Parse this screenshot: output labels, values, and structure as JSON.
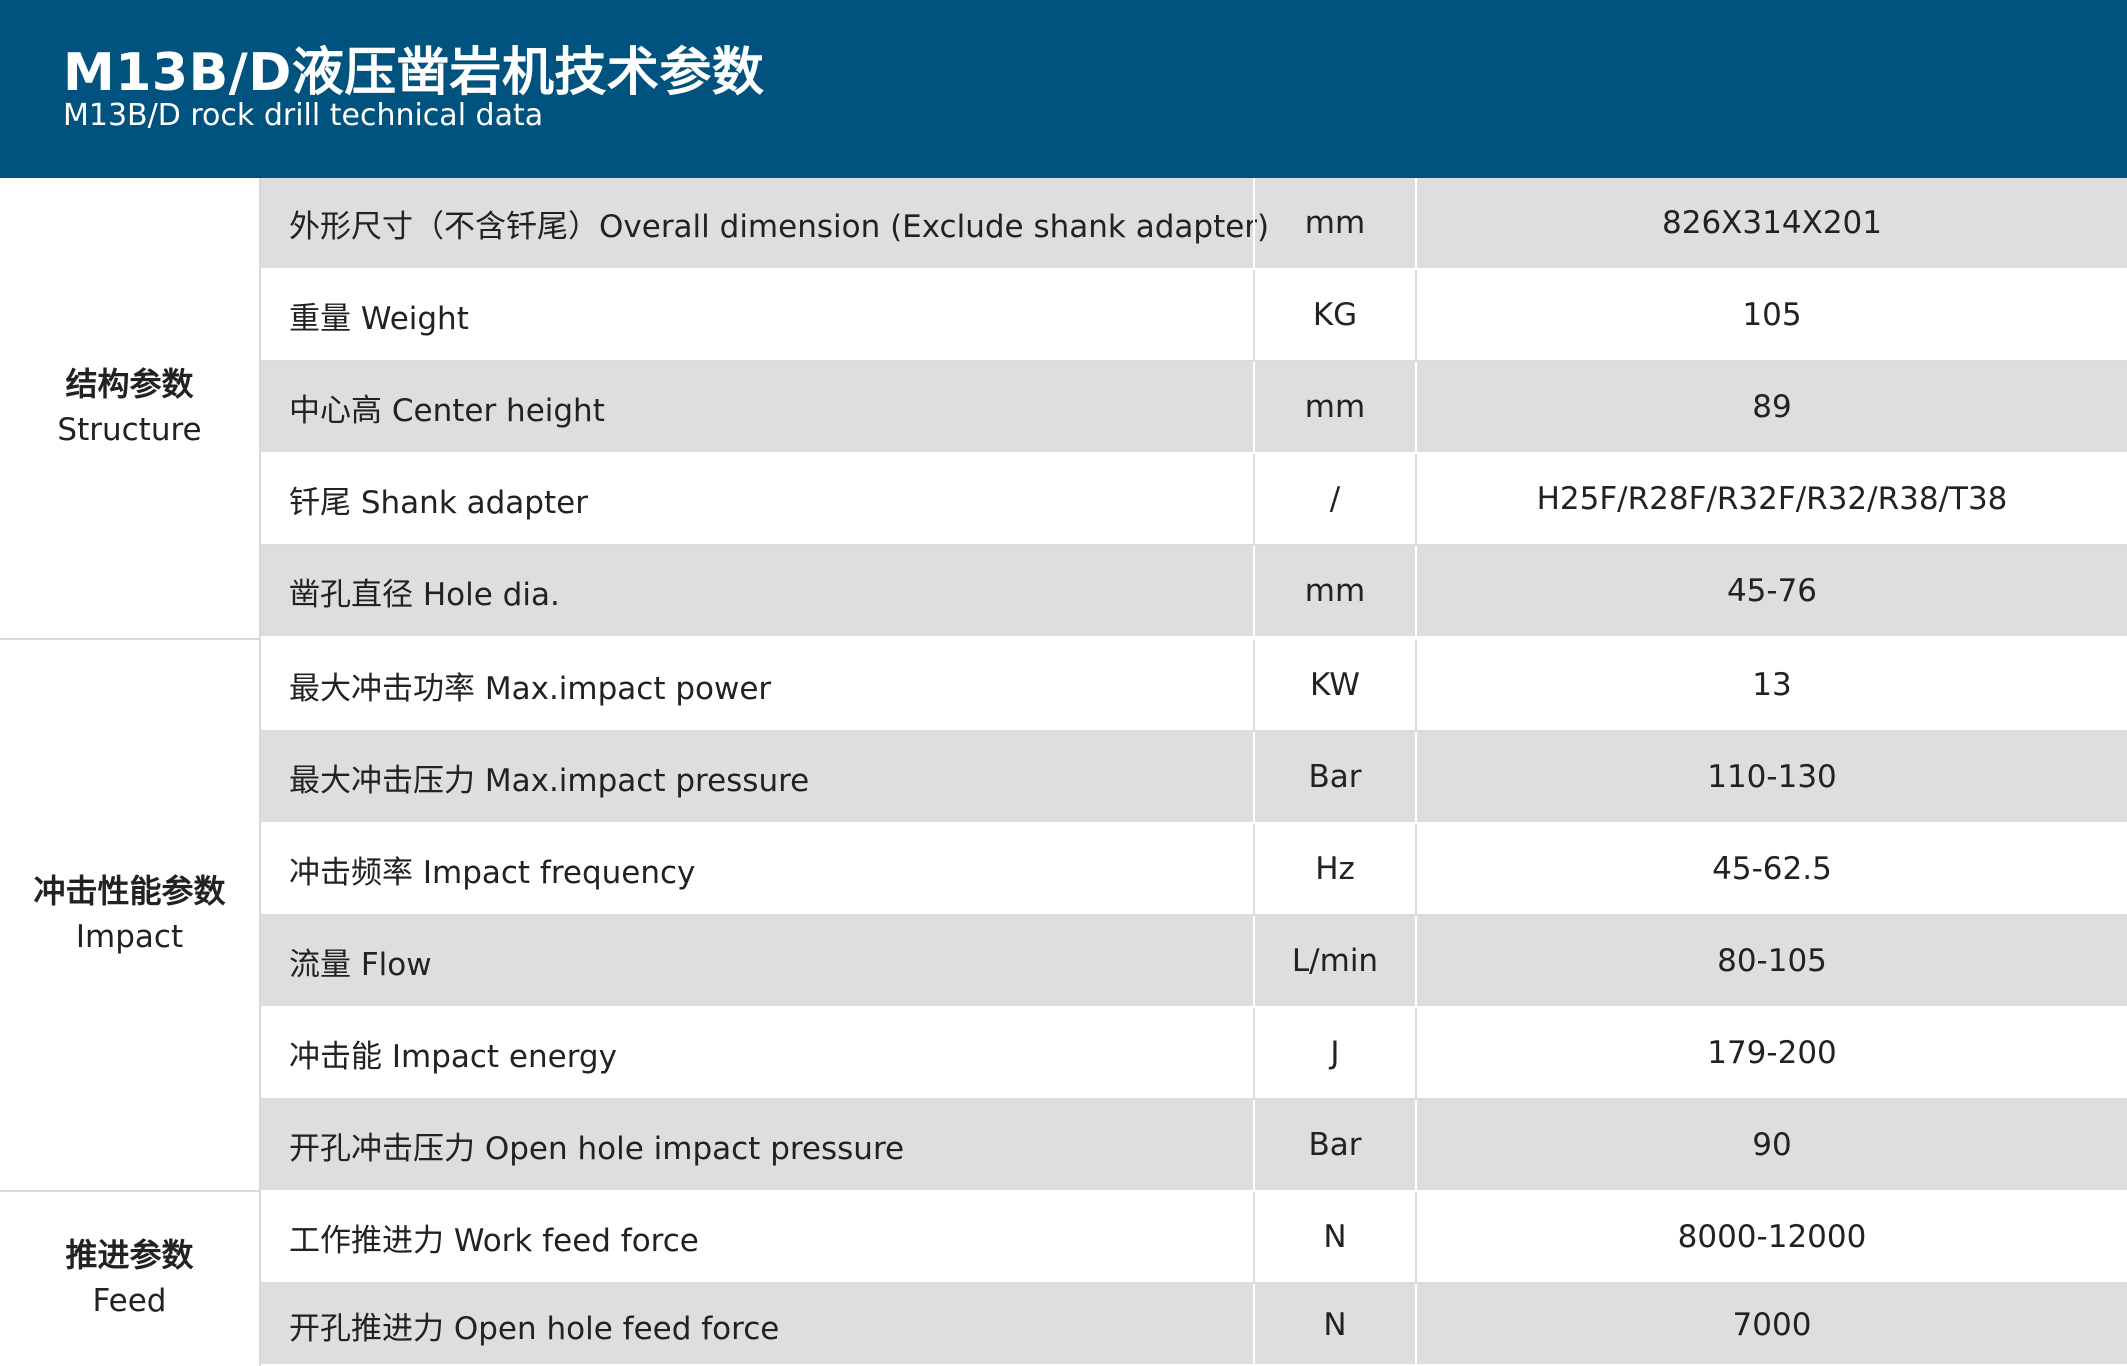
{
  "header": {
    "title": "M13B/D液压凿岩机技术参数",
    "subtitle": "M13B/D rock drill technical data"
  },
  "groups": [
    {
      "zh": "结构参数",
      "en": "Structure"
    },
    {
      "zh": "冲击性能参数",
      "en": "Impact"
    },
    {
      "zh": "推进参数",
      "en": "Feed"
    }
  ],
  "rows": [
    {
      "label": "外形尺寸（不含钎尾）Overall dimension (Exclude shank adapter)",
      "unit": "mm",
      "value": "826X314X201"
    },
    {
      "label": "重量 Weight",
      "unit": "KG",
      "value": "105"
    },
    {
      "label": "中心高 Center height",
      "unit": "mm",
      "value": "89"
    },
    {
      "label": "钎尾 Shank adapter",
      "unit": "/",
      "value": "H25F/R28F/R32F/R32/R38/T38"
    },
    {
      "label": "凿孔直径 Hole dia.",
      "unit": "mm",
      "value": "45-76"
    },
    {
      "label": "最大冲击功率 Max.impact power",
      "unit": "KW",
      "value": "13"
    },
    {
      "label": "最大冲击压力 Max.impact pressure",
      "unit": "Bar",
      "value": "110-130"
    },
    {
      "label": "冲击频率 Impact frequency",
      "unit": "Hz",
      "value": "45-62.5"
    },
    {
      "label": "流量 Flow",
      "unit": "L/min",
      "value": "80-105"
    },
    {
      "label": "冲击能 Impact energy",
      "unit": "J",
      "value": "179-200"
    },
    {
      "label": "开孔冲击压力 Open hole impact pressure",
      "unit": "Bar",
      "value": "90"
    },
    {
      "label": "工作推进力 Work feed force",
      "unit": "N",
      "value": "8000-12000"
    },
    {
      "label": "开孔推进力 Open hole feed force",
      "unit": "N",
      "value": "7000"
    }
  ]
}
